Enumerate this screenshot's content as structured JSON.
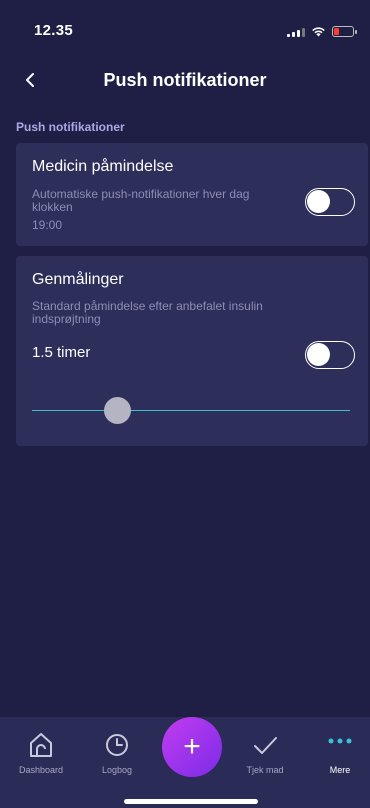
{
  "status_bar": {
    "time": "12.35"
  },
  "header": {
    "title": "Push notifikationer",
    "back_icon": "chevron-left-icon"
  },
  "section_label": "Push notifikationer",
  "cards": {
    "medicine": {
      "title": "Medicin påmindelse",
      "description": "Automatiske push-notifikationer hver dag klokken",
      "time": "19:00",
      "toggle_on": false
    },
    "remeasure": {
      "title": "Genmålinger",
      "description": "Standard påmindelse efter anbefalet insulin indsprøjtning",
      "timer_value": "1.5 timer",
      "toggle_on": false,
      "slider_fraction": 0.27
    }
  },
  "tab_bar": {
    "dashboard": "Dashboard",
    "logbog": "Logbog",
    "add": "+",
    "tjek_mad": "Tjek mad",
    "mere": "Mere"
  },
  "colors": {
    "background": "#1f1f45",
    "card": "#2e2e5a",
    "accent_teal": "#3cc0d4",
    "fab_gradient_start": "#c23cf0",
    "fab_gradient_end": "#7b2ce8",
    "section_label": "#a9a8e6"
  }
}
